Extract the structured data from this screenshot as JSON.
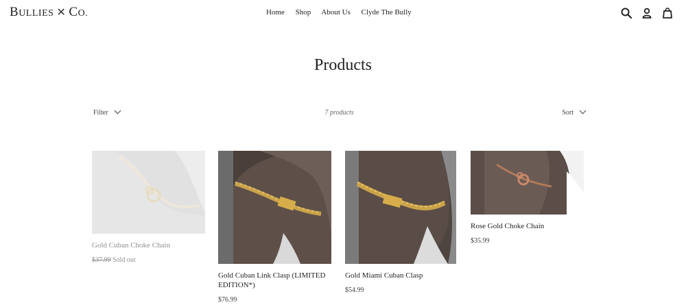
{
  "header": {
    "logo": {
      "b": "B",
      "ullies": "ULLIES",
      "co_c": "C",
      "co_o": "O.",
      "x": "✕"
    },
    "nav": [
      "Home",
      "Shop",
      "About Us",
      "Clyde The Bully"
    ],
    "icons": [
      "search-icon",
      "account-icon",
      "cart-icon"
    ]
  },
  "page": {
    "title": "Products"
  },
  "toolbar": {
    "filter_label": "Filter",
    "count_text": "7 products",
    "sort_label": "Sort"
  },
  "products": [
    {
      "name": "Gold Cuban Choke Chain",
      "price": "$37.99",
      "status": "Sold out",
      "sold_out": true
    },
    {
      "name": "Gold Cuban Link Clasp (LIMITED EDITION*)",
      "price": "$76.99"
    },
    {
      "name": "Gold Miami Cuban Clasp",
      "price": "$54.99"
    },
    {
      "name": "Rose Gold Choke Chain",
      "price": "$35.99"
    }
  ],
  "colors": {
    "text": "#3d4246",
    "gold": "#c9a24a",
    "rose_gold": "#b07a5a",
    "dog_fur": "#5b4d47"
  }
}
